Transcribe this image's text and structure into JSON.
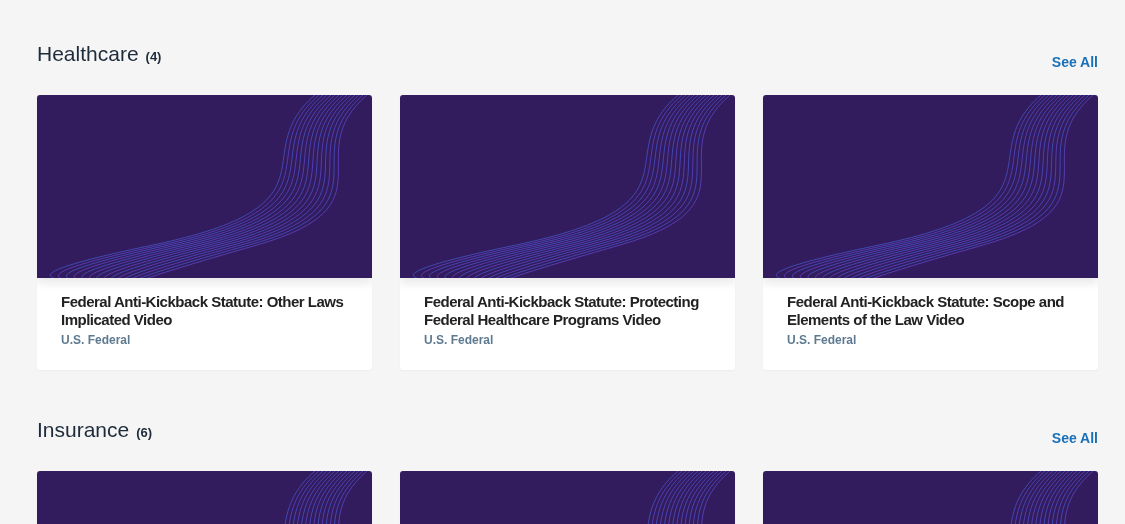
{
  "sections": [
    {
      "title": "Healthcare",
      "count": "(4)",
      "see_all": "See All",
      "cards": [
        {
          "kind": "full",
          "title": "Federal Anti-Kickback Statute: Other Laws Implicated Video",
          "jurisdiction": "U.S. Federal"
        },
        {
          "kind": "full",
          "title": "Federal Anti-Kickback Statute: Protecting Federal Healthcare Programs Video",
          "jurisdiction": "U.S. Federal"
        },
        {
          "kind": "full",
          "title": "Federal Anti-Kickback Statute: Scope and Elements of the Law Video",
          "jurisdiction": "U.S. Federal"
        }
      ]
    },
    {
      "title": "Insurance",
      "count": "(6)",
      "see_all": "See All",
      "cards": [
        {
          "kind": "thumbnail"
        },
        {
          "kind": "thumbnail"
        },
        {
          "kind": "thumbnail"
        }
      ]
    }
  ]
}
